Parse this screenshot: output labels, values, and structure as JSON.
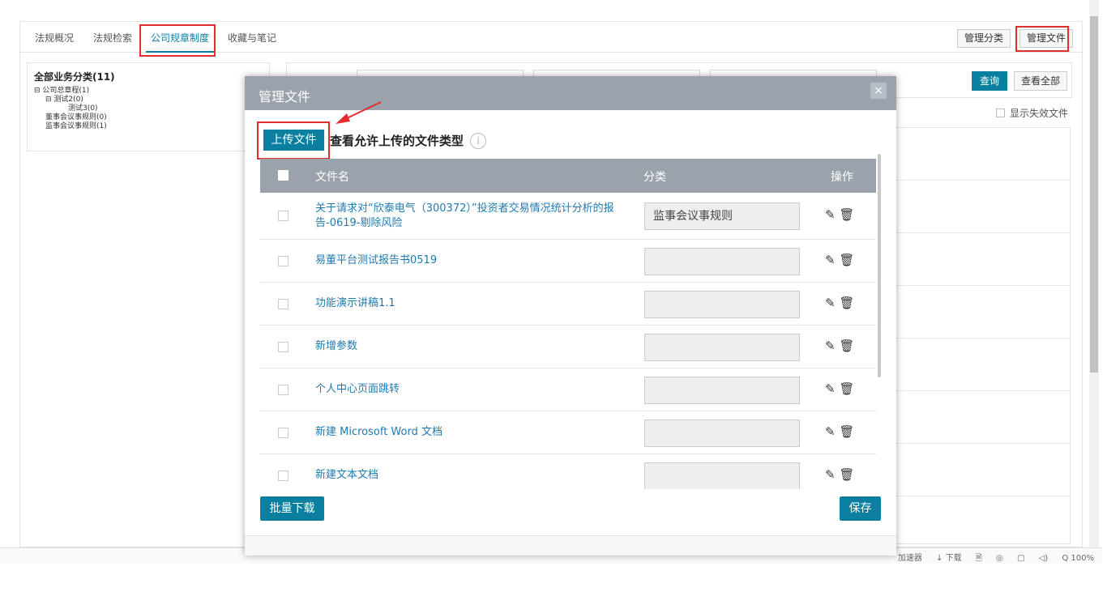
{
  "tabs": [
    {
      "label": "法规概况"
    },
    {
      "label": "法规检索"
    },
    {
      "label": "公司规章制度"
    },
    {
      "label": "收藏与笔记"
    }
  ],
  "top_buttons": {
    "manage_category": "管理分类",
    "manage_files": "管理文件"
  },
  "tree": {
    "title": "全部业务分类(11)",
    "items": [
      "⊟ 公司总章程(1)",
      "⊟ 测试2(0)",
      "测试3(0)",
      "董事会议事规则(0)",
      "监事会议事规则(1)"
    ]
  },
  "search": {
    "query_label": "查询",
    "view_all_label": "查看全部",
    "show_invalid_label": "显示失效文件"
  },
  "modal": {
    "title": "管理文件",
    "close": "×",
    "upload_label": "上传文件",
    "upload_types_label": "查看允许上传的文件类型",
    "info": "i",
    "columns": {
      "name": "文件名",
      "category": "分类",
      "ops": "操作"
    },
    "rows": [
      {
        "name": "关于请求对“欣泰电气（300372）”投资者交易情况统计分析的报告-0619-剔除风险",
        "category": "监事会议事规则"
      },
      {
        "name": "易董平台测试报告书0519",
        "category": ""
      },
      {
        "name": "功能演示讲稿1.1",
        "category": ""
      },
      {
        "name": "新增参数",
        "category": ""
      },
      {
        "name": "个人中心页面跳转",
        "category": ""
      },
      {
        "name": "新建 Microsoft Word 文档",
        "category": ""
      },
      {
        "name": "新建文本文档",
        "category": ""
      }
    ],
    "ops_icons": [
      "edit-icon",
      "trash-icon"
    ],
    "batch_download_label": "批量下载",
    "save_label": "保存"
  },
  "statusbar": {
    "items": [
      "加速器",
      "↓ 下载",
      "🗎",
      "◎",
      "▢",
      "◁)",
      "Q 100%"
    ]
  }
}
